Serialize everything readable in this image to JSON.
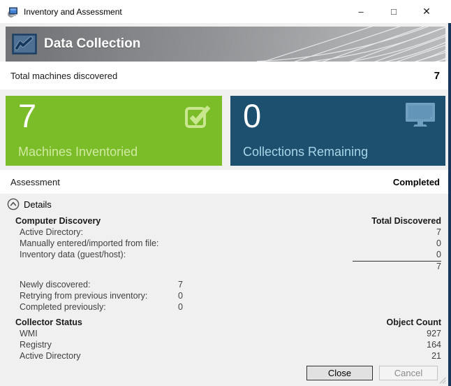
{
  "window": {
    "title": "Inventory and Assessment",
    "controls": {
      "minimize": "–",
      "maximize": "□",
      "close": "✕"
    }
  },
  "header": {
    "title": "Data Collection"
  },
  "summary": {
    "label": "Total machines discovered",
    "value": "7"
  },
  "tiles": [
    {
      "value": "7",
      "label": "Machines Inventoried",
      "icon": "checkbox-check-icon",
      "bg": "#7bbc29"
    },
    {
      "value": "0",
      "label": "Collections Remaining",
      "icon": "monitor-icon",
      "bg": "#1d4f6e"
    }
  ],
  "assessment": {
    "label": "Assessment",
    "status": "Completed"
  },
  "details": {
    "toggle_label": "Details",
    "computer_discovery": {
      "heading": "Computer Discovery",
      "value_heading": "Total Discovered",
      "rows": [
        {
          "label": "Active Directory:",
          "value": "7"
        },
        {
          "label": "Manually entered/imported from file:",
          "value": "0"
        },
        {
          "label": "Inventory data (guest/host):",
          "value": "0"
        }
      ],
      "total": "7"
    },
    "inventory_progress": {
      "rows": [
        {
          "label": "Newly discovered:",
          "value": "7"
        },
        {
          "label": "Retrying from previous inventory:",
          "value": "0"
        },
        {
          "label": "Completed previously:",
          "value": "0"
        }
      ]
    },
    "collector_status": {
      "heading": "Collector Status",
      "value_heading": "Object Count",
      "rows": [
        {
          "label": "WMI",
          "value": "927"
        },
        {
          "label": "Registry",
          "value": "164"
        },
        {
          "label": "Active Directory",
          "value": "21"
        }
      ]
    }
  },
  "buttons": {
    "close": "Close",
    "cancel": "Cancel"
  },
  "colors": {
    "green_tile": "#7bbc29",
    "blue_tile": "#1d4f6e",
    "header_gradient_start": "#6f7174",
    "header_gradient_end": "#b9babc",
    "right_edge_strip": "#16365c"
  }
}
